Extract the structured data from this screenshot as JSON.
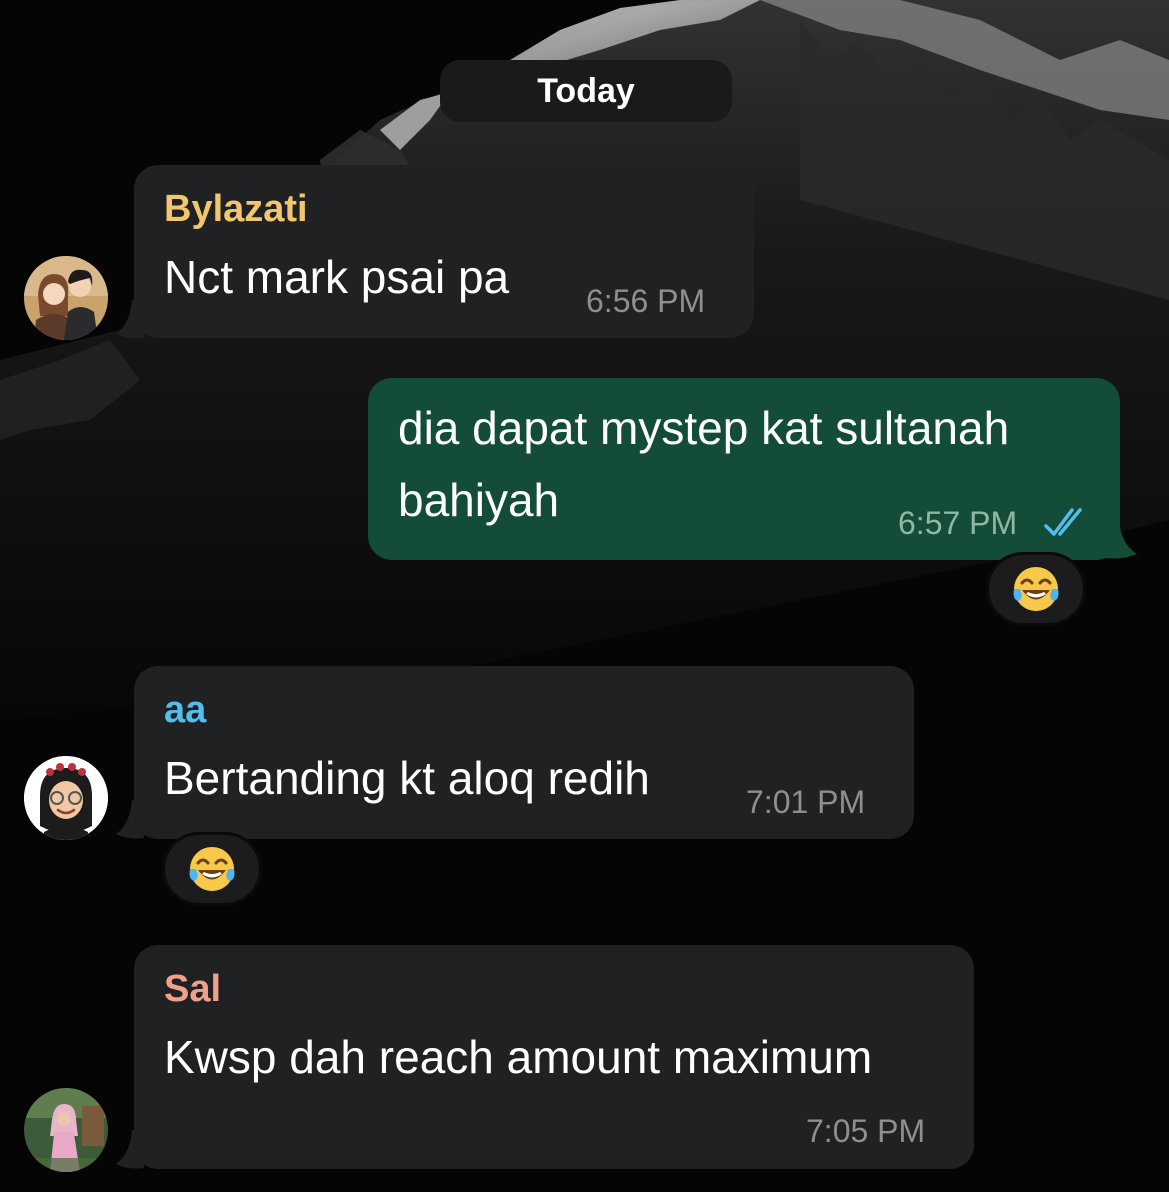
{
  "date_separator": "Today",
  "messages": [
    {
      "sender": "Bylazati",
      "sender_color": "#f2c66d",
      "text": "Nct mark psai pa",
      "time": "6:56 PM",
      "direction": "incoming",
      "avatar_icon": "profile-photo-couple-illustration"
    },
    {
      "text_lines": [
        "dia dapat mystep kat sultanah",
        "bahiyah"
      ],
      "time": "6:57 PM",
      "direction": "outgoing",
      "status_icon": "double-check-read-icon",
      "reaction": "😂"
    },
    {
      "sender": "aa",
      "sender_color": "#53bdeb",
      "text": "Bertanding kt aloq redih",
      "time": "7:01 PM",
      "direction": "incoming",
      "avatar_icon": "profile-memoji-glasses",
      "reaction": "😂"
    },
    {
      "sender": "Sal",
      "sender_color": "#f2a08a",
      "text": "Kwsp dah reach amount maximum",
      "time": "7:05 PM",
      "direction": "incoming",
      "avatar_icon": "profile-photo-person"
    }
  ],
  "colors": {
    "incoming_bubble": "#202122",
    "outgoing_bubble": "#134d37",
    "read_ticks": "#53bdeb",
    "background": "#050505"
  }
}
